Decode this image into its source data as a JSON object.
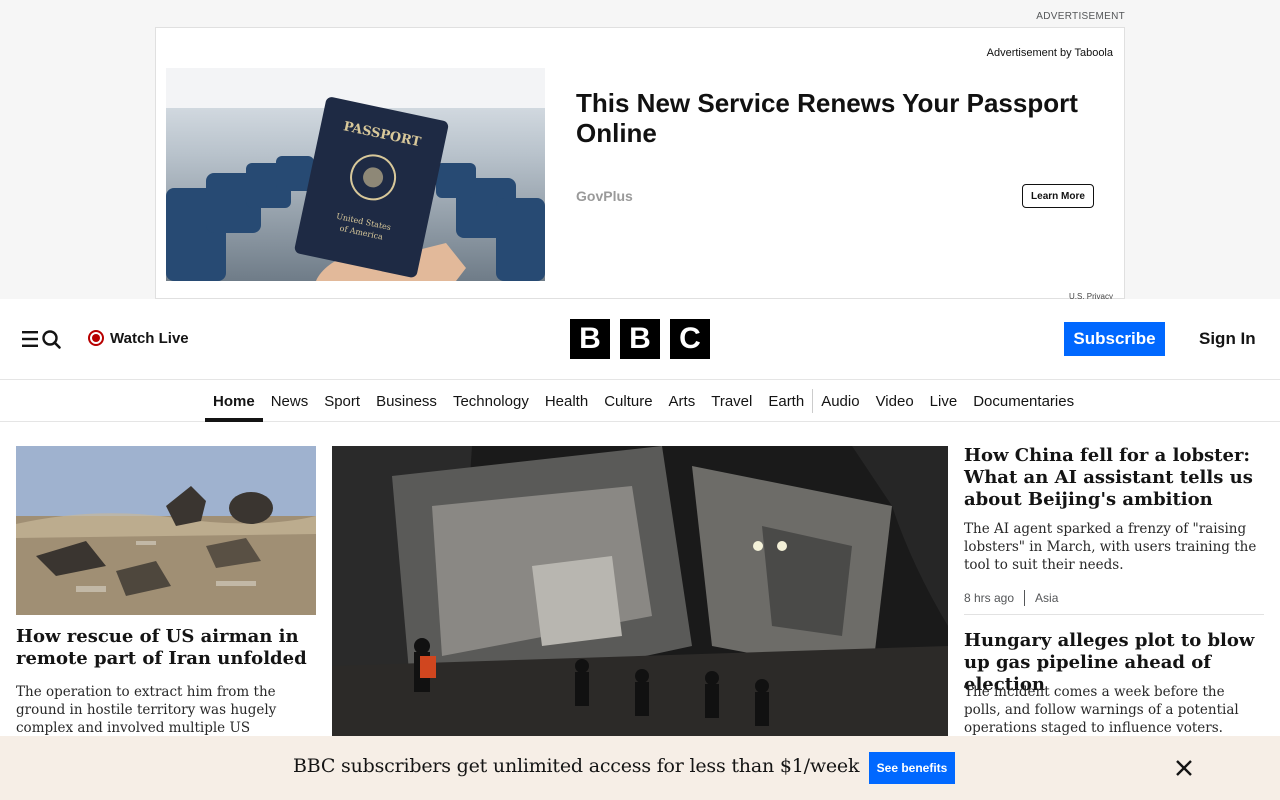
{
  "ad": {
    "label": "ADVERTISEMENT",
    "by_line": "Advertisement by Taboola",
    "headline": "This New Service Renews Your Passport Online",
    "brand": "GovPlus",
    "cta": "Learn More",
    "privacy": "U.S. Privacy",
    "passport_title": "PASSPORT",
    "passport_sub1": "United States",
    "passport_sub2": "of America"
  },
  "header": {
    "menu_icon": "menu-search-icon",
    "watch_live": "Watch Live",
    "logo_letters": [
      "B",
      "B",
      "C"
    ],
    "subscribe": "Subscribe",
    "sign_in": "Sign In"
  },
  "nav": {
    "items": [
      "Home",
      "News",
      "Sport",
      "Business",
      "Technology",
      "Health",
      "Culture",
      "Arts",
      "Travel",
      "Earth",
      "Audio",
      "Video",
      "Live",
      "Documentaries"
    ],
    "active": "Home"
  },
  "stories": {
    "left": {
      "headline": "How rescue of US airman in remote part of Iran unfolded",
      "summary": "The operation to extract him from the ground in hostile territory was hugely complex and involved multiple US"
    },
    "right1": {
      "headline": "How China fell for a lobster: What an AI assistant tells us about Beijing's ambition",
      "summary": "The AI agent sparked a frenzy of \"raising lobsters\" in March, with users training the tool to suit their needs.",
      "time": "8 hrs ago",
      "section": "Asia"
    },
    "right2": {
      "headline": "Hungary alleges plot to blow up gas pipeline ahead of election",
      "summary": "The incident comes a week before the polls, and follow warnings of a potential operations staged to influence voters."
    }
  },
  "banner": {
    "text": "BBC subscribers get unlimited access for less than $1/week",
    "cta": "See benefits"
  },
  "colors": {
    "accent_blue": "#0068ff",
    "live_red": "#b80000",
    "banner_bg": "#f6eee6"
  }
}
